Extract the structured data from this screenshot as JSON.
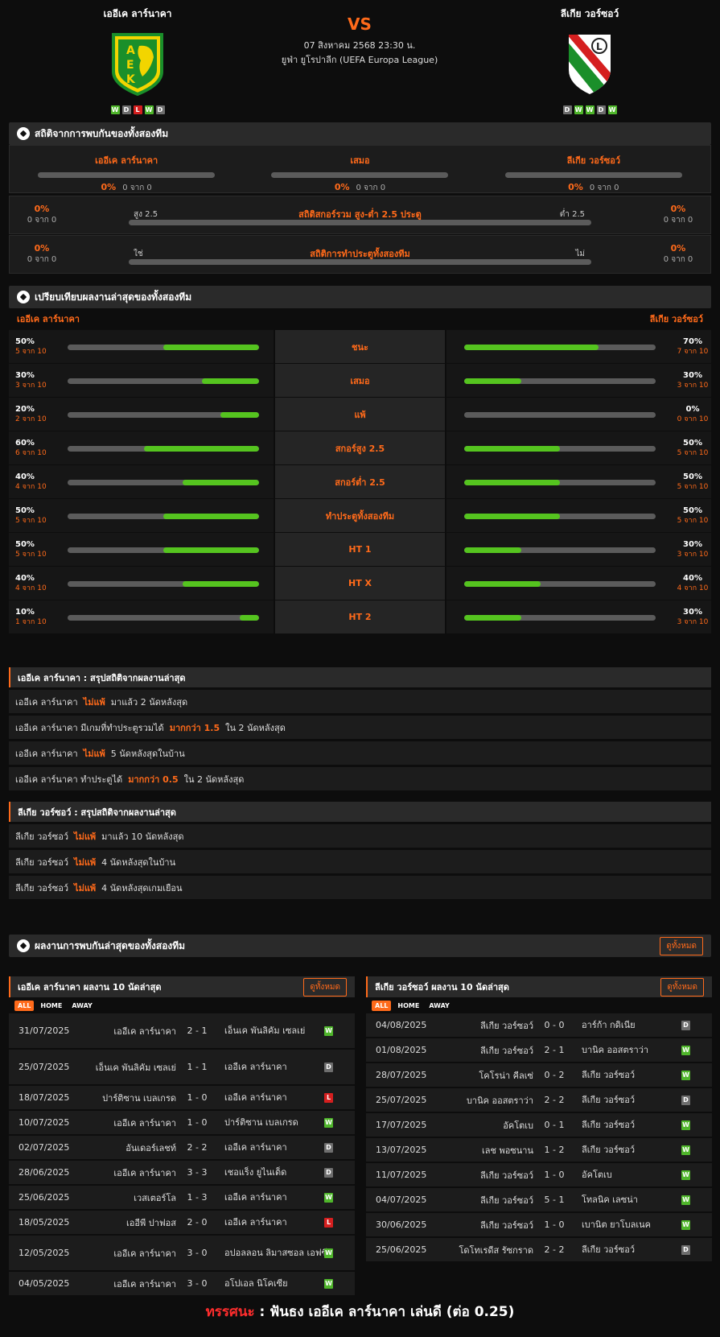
{
  "header": {
    "home": {
      "name": "เออีเค ลาร์นาคา",
      "form": [
        "W",
        "D",
        "L",
        "W",
        "D"
      ]
    },
    "away": {
      "name": "ลีเกีย วอร์ซอว์",
      "form": [
        "D",
        "W",
        "W",
        "D",
        "W"
      ]
    },
    "vs": "VS",
    "datetime": "07 สิงหาคม 2568 23:30 น.",
    "league": "ยูฟ่า ยูโรปาลีก (UEFA Europa League)"
  },
  "h2h": {
    "title": "สถิติจากการพบกันของทั้งสองทีม",
    "cols": [
      {
        "label": "เออีเค ลาร์นาคา",
        "pct": "0%",
        "count": "0 จาก 0",
        "value": 0
      },
      {
        "label": "เสมอ",
        "pct": "0%",
        "count": "0 จาก 0",
        "value": 0
      },
      {
        "label": "ลีเกีย วอร์ซอว์",
        "pct": "0%",
        "count": "0 จาก 0",
        "value": 0
      }
    ],
    "ou": {
      "title": "สถิติสกอร์รวม สูง-ต่ำ 2.5 ประตู",
      "left": "สูง 2.5",
      "right": "ต่ำ 2.5",
      "lp": "0%",
      "lc": "0 จาก 0",
      "rp": "0%",
      "rc": "0 จาก 0"
    },
    "bts": {
      "title": "สถิติการทำประตูทั้งสองทีม",
      "left": "ใช่",
      "right": "ไม่",
      "lp": "0%",
      "lc": "0 จาก 0",
      "rp": "0%",
      "rc": "0 จาก 0"
    }
  },
  "compare": {
    "title": "เปรียบเทียบผลงานล่าสุดของทั้งสองทีม",
    "home": "เออีเค ลาร์นาคา",
    "away": "ลีเกีย วอร์ซอว์",
    "rows": [
      {
        "label": "ชนะ",
        "h": 50,
        "hp": "50%",
        "hc": "5 จาก 10",
        "a": 70,
        "ap": "70%",
        "ac": "7 จาก 10"
      },
      {
        "label": "เสมอ",
        "h": 30,
        "hp": "30%",
        "hc": "3 จาก 10",
        "a": 30,
        "ap": "30%",
        "ac": "3 จาก 10"
      },
      {
        "label": "แพ้",
        "h": 20,
        "hp": "20%",
        "hc": "2 จาก 10",
        "a": 0,
        "ap": "0%",
        "ac": "0 จาก 10"
      },
      {
        "label": "สกอร์สูง 2.5",
        "h": 60,
        "hp": "60%",
        "hc": "6 จาก 10",
        "a": 50,
        "ap": "50%",
        "ac": "5 จาก 10"
      },
      {
        "label": "สกอร์ต่ำ 2.5",
        "h": 40,
        "hp": "40%",
        "hc": "4 จาก 10",
        "a": 50,
        "ap": "50%",
        "ac": "5 จาก 10"
      },
      {
        "label": "ทำประตูทั้งสองทีม",
        "h": 50,
        "hp": "50%",
        "hc": "5 จาก 10",
        "a": 50,
        "ap": "50%",
        "ac": "5 จาก 10"
      },
      {
        "label": "HT 1",
        "h": 50,
        "hp": "50%",
        "hc": "5 จาก 10",
        "a": 30,
        "ap": "30%",
        "ac": "3 จาก 10"
      },
      {
        "label": "HT X",
        "h": 40,
        "hp": "40%",
        "hc": "4 จาก 10",
        "a": 40,
        "ap": "40%",
        "ac": "4 จาก 10"
      },
      {
        "label": "HT 2",
        "h": 10,
        "hp": "10%",
        "hc": "1 จาก 10",
        "a": 30,
        "ap": "30%",
        "ac": "3 จาก 10"
      }
    ]
  },
  "summaryA": {
    "title": "เออีเค ลาร์นาคา : สรุปสถิติจากผลงานล่าสุด",
    "rows": [
      [
        "เออีเค ลาร์นาคา",
        "ไม่แพ้",
        "มาแล้ว 2 นัดหลังสุด"
      ],
      [
        "เออีเค ลาร์นาคา มีเกมที่ทำประตูรวมได้",
        "มากกว่า 1.5",
        "ใน 2 นัดหลังสุด"
      ],
      [
        "เออีเค ลาร์นาคา",
        "ไม่แพ้",
        "5 นัดหลังสุดในบ้าน"
      ],
      [
        "เออีเค ลาร์นาคา ทำประตูได้",
        "มากกว่า 0.5",
        "ใน 2 นัดหลังสุด"
      ]
    ]
  },
  "summaryB": {
    "title": "ลีเกีย วอร์ซอว์ : สรุปสถิติจากผลงานล่าสุด",
    "rows": [
      [
        "ลีเกีย วอร์ซอว์",
        "ไม่แพ้",
        "มาแล้ว 10 นัดหลังสุด"
      ],
      [
        "ลีเกีย วอร์ซอว์",
        "ไม่แพ้",
        "4 นัดหลังสุดในบ้าน"
      ],
      [
        "ลีเกีย วอร์ซอว์",
        "ไม่แพ้",
        "4 นัดหลังสุดเกมเยือน"
      ]
    ]
  },
  "recent": {
    "title": "ผลงานการพบกันล่าสุดของทั้งสองทีม",
    "view_all": "ดูทั้งหมด",
    "tabs": [
      "ALL",
      "HOME",
      "AWAY"
    ],
    "home": {
      "title": "เออีเค ลาร์นาคา ผลงาน 10 นัดล่าสุด",
      "matches": [
        [
          "31/07/2025",
          "เออีเค ลาร์นาคา",
          "2 - 1",
          "เอ็นเค พันลิคัม เซลเย่",
          "W"
        ],
        [
          "25/07/2025",
          "เอ็นเค พันลิคัม เซลเย่",
          "1 - 1",
          "เออีเค ลาร์นาคา",
          "D"
        ],
        [
          "18/07/2025",
          "ปาร์ติซาน เบลเกรด",
          "1 - 0",
          "เออีเค ลาร์นาคา",
          "L"
        ],
        [
          "10/07/2025",
          "เออีเค ลาร์นาคา",
          "1 - 0",
          "ปาร์ติซาน เบลเกรด",
          "W"
        ],
        [
          "02/07/2025",
          "อันเดอร์เลชท์",
          "2 - 2",
          "เออีเค ลาร์นาคา",
          "D"
        ],
        [
          "28/06/2025",
          "เออีเค ลาร์นาคา",
          "3 - 3",
          "เชอแร็ง ยูไนเต็ด",
          "D"
        ],
        [
          "25/06/2025",
          "เวสเตอร์โล",
          "1 - 3",
          "เออีเค ลาร์นาคา",
          "W"
        ],
        [
          "18/05/2025",
          "เออีพี ปาฟอส",
          "2 - 0",
          "เออีเค ลาร์นาคา",
          "L"
        ],
        [
          "12/05/2025",
          "เออีเค ลาร์นาคา",
          "3 - 0",
          "อปอลลอน ลิมาสซอล เอฟซี",
          "W"
        ],
        [
          "04/05/2025",
          "เออีเค ลาร์นาคา",
          "3 - 0",
          "อโปเอล นิโคเซีย",
          "W"
        ]
      ]
    },
    "away": {
      "title": "ลีเกีย วอร์ซอว์ ผลงาน 10 นัดล่าสุด",
      "matches": [
        [
          "04/08/2025",
          "ลีเกีย วอร์ซอว์",
          "0 - 0",
          "อาร์ก้า กดิเนีย",
          "D"
        ],
        [
          "01/08/2025",
          "ลีเกีย วอร์ซอว์",
          "2 - 1",
          "บานิค ออสตราว่า",
          "W"
        ],
        [
          "28/07/2025",
          "โคโรน่า คีลเซ่",
          "0 - 2",
          "ลีเกีย วอร์ซอว์",
          "W"
        ],
        [
          "25/07/2025",
          "บานิค ออสตราว่า",
          "2 - 2",
          "ลีเกีย วอร์ซอว์",
          "D"
        ],
        [
          "17/07/2025",
          "อัคโตเบ",
          "0 - 1",
          "ลีเกีย วอร์ซอว์",
          "W"
        ],
        [
          "13/07/2025",
          "เลช พอซนาน",
          "1 - 2",
          "ลีเกีย วอร์ซอว์",
          "W"
        ],
        [
          "11/07/2025",
          "ลีเกีย วอร์ซอว์",
          "1 - 0",
          "อัคโตเบ",
          "W"
        ],
        [
          "04/07/2025",
          "ลีเกีย วอร์ซอว์",
          "5 - 1",
          "โทลนิค เลซน่า",
          "W"
        ],
        [
          "30/06/2025",
          "ลีเกีย วอร์ซอว์",
          "1 - 0",
          "เบานิต ยาโบลเนค",
          "W"
        ],
        [
          "25/06/2025",
          "โดโทเรดีส รัซกราด",
          "2 - 2",
          "ลีเกีย วอร์ซอว์",
          "D"
        ]
      ]
    }
  },
  "verdict": {
    "label": "ทรรศนะ",
    "sep": ":",
    "text": "ฟันธง เออีเค ลาร์นาคา เล่นดี (ต่อ 0.25)"
  },
  "colors": {
    "accent": "#ff6a1a",
    "win": "#4fb62b",
    "draw": "#6e6e6e",
    "loss": "#d51f1f",
    "bar": "#55c41f"
  }
}
